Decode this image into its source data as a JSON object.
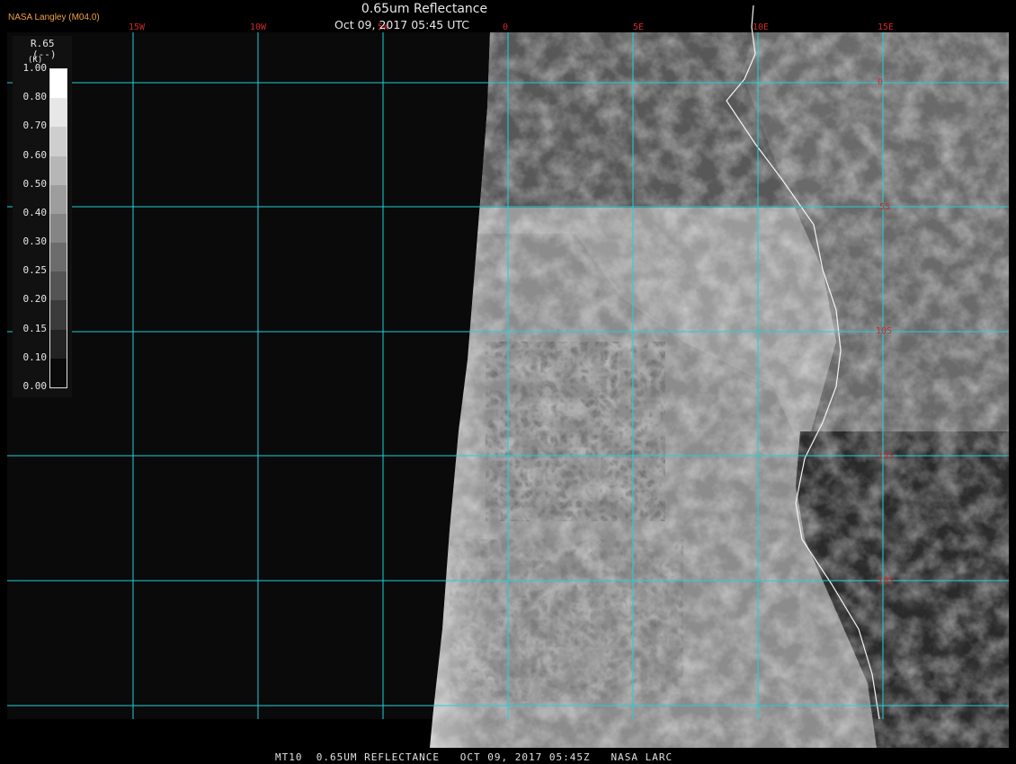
{
  "header": {
    "credit": "NASA Langley (M04.0)",
    "title": "0.65um Reflectance",
    "subtitle": "Oct 09, 2017 05:45 UTC"
  },
  "footer": {
    "caption": "MT10  0.65UM REFLECTANCE   OCT 09, 2017 05:45Z   NASA LARC"
  },
  "legend": {
    "label": "R.65",
    "units": "(--)",
    "extra": "(K)",
    "ticks": [
      "1.00",
      "0.80",
      "0.70",
      "0.60",
      "0.50",
      "0.40",
      "0.30",
      "0.25",
      "0.20",
      "0.15",
      "0.10",
      "0.00"
    ]
  },
  "grid": {
    "longitude_labels": [
      "15W",
      "10W",
      "5W",
      "0",
      "5E",
      "10E",
      "15E"
    ],
    "latitude_labels": [
      "0",
      "5S",
      "10S",
      "15S",
      "20S"
    ],
    "line_color": "#20d0d8",
    "label_color": "#d02828"
  },
  "map": {
    "projection": "geostationary satellite view",
    "region": "Southeast Atlantic / southwest Africa coast"
  }
}
